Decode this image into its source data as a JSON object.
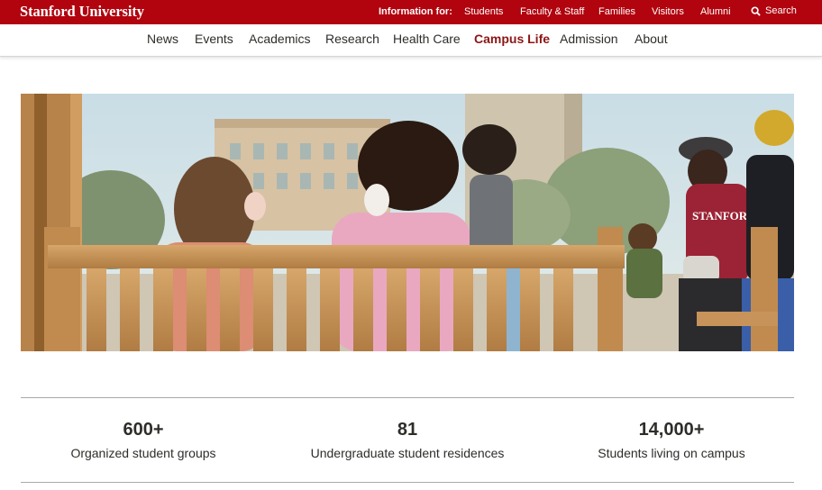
{
  "header": {
    "logo_text": "Stanford University",
    "info_label": "Information for:",
    "audiences": [
      "Students",
      "Faculty & Staff",
      "Families",
      "Visitors",
      "Alumni"
    ],
    "search_label": "Search",
    "brand_color": "#b1040e"
  },
  "nav": {
    "items": [
      "News",
      "Events",
      "Academics",
      "Research",
      "Health Care",
      "Campus Life",
      "Admission",
      "About"
    ],
    "active": "Campus Life",
    "active_color": "#8c1515"
  },
  "stats": [
    {
      "number": "600+",
      "label": "Organized student groups"
    },
    {
      "number": "81",
      "label": "Undergraduate student residences"
    },
    {
      "number": "14,000+",
      "label": "Students living on campus"
    }
  ]
}
